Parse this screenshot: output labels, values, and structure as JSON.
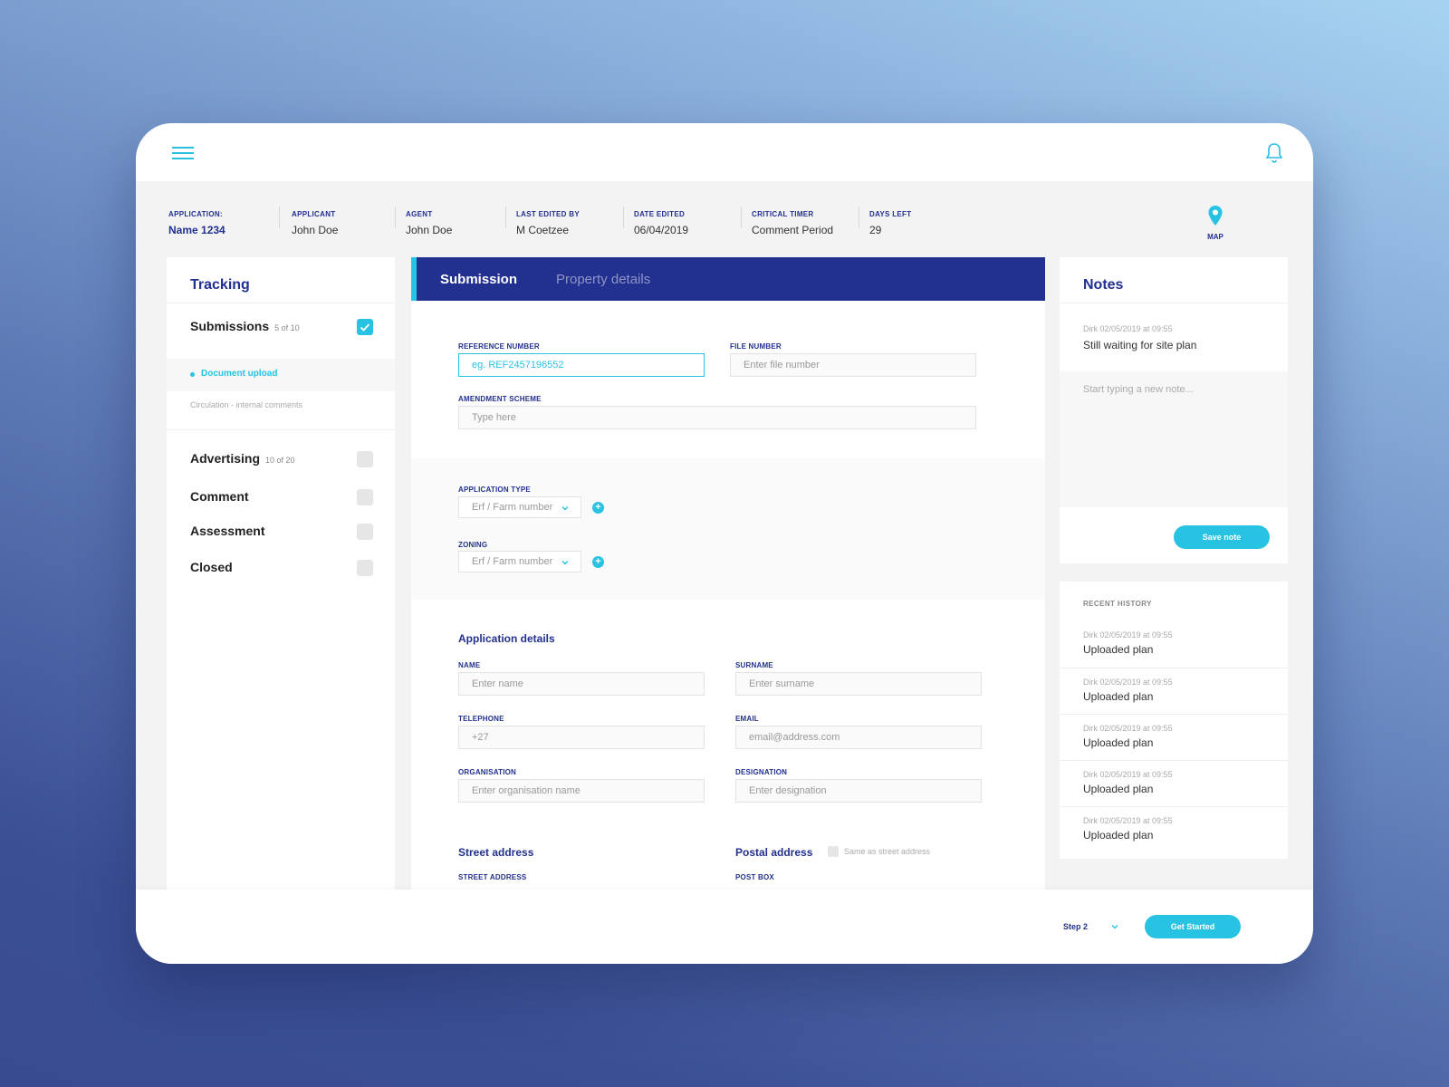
{
  "header": {
    "menu_icon": "hamburger-menu-icon",
    "bell_icon": "bell-icon"
  },
  "info": [
    {
      "label": "APPLICATION:",
      "value": "Name 1234"
    },
    {
      "label": "APPLICANT",
      "value": "John Doe"
    },
    {
      "label": "AGENT",
      "value": "John Doe"
    },
    {
      "label": "LAST EDITED BY",
      "value": "M Coetzee"
    },
    {
      "label": "DATE EDITED",
      "value": "06/04/2019"
    },
    {
      "label": "CRITICAL TIMER",
      "value": "Comment Period"
    },
    {
      "label": "DAYS LEFT",
      "value": "29"
    }
  ],
  "map": {
    "label": "MAP",
    "icon": "map-pin-icon"
  },
  "tracking": {
    "title": "Tracking",
    "submissions": {
      "label": "Submissions",
      "count": "5 of 10"
    },
    "sub_items": [
      "Document upload",
      "Circulation - internal comments"
    ],
    "advertising": {
      "label": "Advertising",
      "count": "10 of 20"
    },
    "comment": "Comment",
    "assessment": "Assessment",
    "closed": "Closed"
  },
  "tabs": {
    "active": "Submission",
    "inactive": "Property details"
  },
  "form": {
    "reference_label": "REFERENCE NUMBER",
    "reference_value": "eg. REF2457196552",
    "file_label": "FILE NUMBER",
    "file_placeholder": "Enter file number",
    "amendment_label": "AMENDMENT SCHEME",
    "amendment_placeholder": "Type here",
    "app_type_label": "APPLICATION TYPE",
    "app_type_value": "Erf / Farm number",
    "zoning_label": "ZONING",
    "zoning_value": "Erf / Farm number",
    "details_title": "Application details",
    "name_label": "NAME",
    "name_placeholder": "Enter name",
    "surname_label": "SURNAME",
    "surname_placeholder": "Enter surname",
    "telephone_label": "TELEPHONE",
    "telephone_placeholder": "+27",
    "email_label": "EMAIL",
    "email_placeholder": "email@address.com",
    "org_label": "ORGANISATION",
    "org_placeholder": "Enter organisation name",
    "designation_label": "DESIGNATION",
    "designation_placeholder": "Enter designation",
    "street_title": "Street address",
    "postal_title": "Postal address",
    "same_as_label": "Same as street address",
    "street_label": "STREET ADDRESS",
    "postbox_label": "POST BOX"
  },
  "notes": {
    "title": "Notes",
    "meta": "Dirk 02/05/2019 at 09:55",
    "text": "Still waiting for site plan",
    "new_placeholder": "Start typing a new note...",
    "save_label": "Save note"
  },
  "history": {
    "title": "RECENT HISTORY",
    "items": [
      {
        "meta": "Dirk 02/05/2019 at 09:55",
        "text": "Uploaded plan"
      },
      {
        "meta": "Dirk 02/05/2019 at 09:55",
        "text": "Uploaded plan"
      },
      {
        "meta": "Dirk 02/05/2019 at 09:55",
        "text": "Uploaded plan"
      },
      {
        "meta": "Dirk 02/05/2019 at 09:55",
        "text": "Uploaded plan"
      },
      {
        "meta": "Dirk 02/05/2019 at 09:55",
        "text": "Uploaded plan"
      }
    ]
  },
  "footer": {
    "step": "Step 2",
    "cta": "Get Started"
  },
  "colors": {
    "accent": "#28c3e3",
    "brand": "#22308f"
  }
}
